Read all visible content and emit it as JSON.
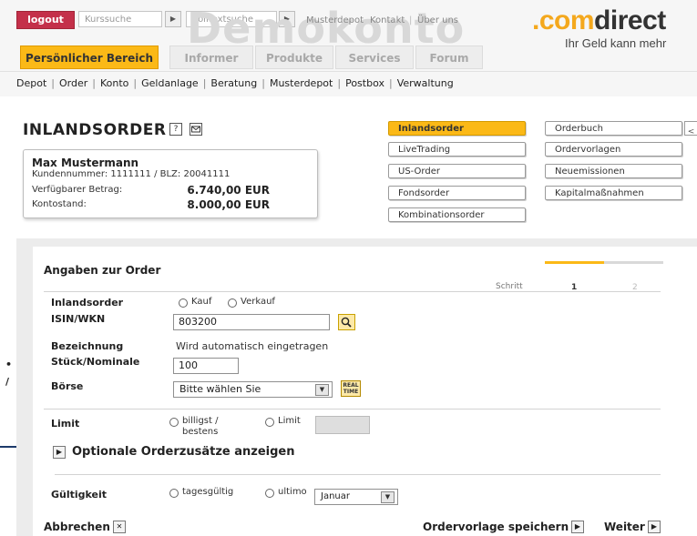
{
  "header": {
    "logout": "logout",
    "search_placeholder": "Kurssuche",
    "fulltext_placeholder": "Volltextsuche",
    "watermark": "Demokonto",
    "links": [
      "Musterdepot",
      "Kontakt",
      "Über uns"
    ],
    "logo_prefix": ".",
    "logo_com": "com",
    "logo_rest": "direct",
    "slogan": "Ihr Geld kann mehr",
    "tabs": [
      "Persönlicher Bereich",
      "Informer",
      "Produkte",
      "Services",
      "Forum"
    ],
    "active_tab": "Persönlicher Bereich"
  },
  "subnav": [
    "Depot",
    "Order",
    "Konto",
    "Geldanlage",
    "Beratung",
    "Musterdepot",
    "Postbox",
    "Verwaltung"
  ],
  "page": {
    "title": "INLANDSORDER",
    "help_icon": "?",
    "mail_icon": "mail-icon"
  },
  "customer": {
    "name": "Max Mustermann",
    "number_line": "Kundennummer: 1111111 / BLZ: 20041111",
    "available_label": "Verfügbarer Betrag:",
    "available_value": "6.740,00 EUR",
    "balance_label": "Kontostand:",
    "balance_value": "8.000,00 EUR"
  },
  "order_types": {
    "left": [
      "Inlandsorder",
      "LiveTrading",
      "US-Order",
      "Fondsorder",
      "Kombinationsorder"
    ],
    "right": [
      "Orderbuch",
      "Ordervorlagen",
      "Neuemissionen",
      "Kapitalmaßnahmen"
    ],
    "active": "Inlandsorder",
    "edge_glyph": "<"
  },
  "order": {
    "section_title": "Angaben zur Order",
    "step_label": "Schritt",
    "steps": [
      "1",
      "2"
    ],
    "current_step_fraction": 0.5,
    "fields": {
      "type_label": "Inlandsorder",
      "buy": "Kauf",
      "sell": "Verkauf",
      "isin_label": "ISIN/WKN",
      "isin_value": "803200",
      "name_label": "Bezeichnung",
      "name_value": "Wird automatisch eingetragen",
      "qty_label": "Stück/Nominale",
      "qty_value": "100",
      "exchange_label": "Börse",
      "exchange_value": "Bitte wählen Sie",
      "realtime_l1": "REAL",
      "realtime_l2": "TIME",
      "limit_label": "Limit",
      "limit_opt1_l1": "billigst /",
      "limit_opt1_l2": "bestens",
      "limit_opt2": "Limit",
      "optional_label": "Optionale Orderzusätze anzeigen",
      "validity_label": "Gültigkeit",
      "validity_opt1": "tagesgültig",
      "validity_opt2": "ultimo",
      "month_value": "Januar"
    },
    "footer": {
      "cancel": "Abbrechen",
      "save": "Ordervorlage speichern",
      "next": "Weiter"
    }
  },
  "left_margin": {
    "bullet": "•",
    "slash": "/"
  },
  "colors": {
    "accent": "#fbb917",
    "logout": "#c4304a",
    "panel_bg": "#ececec"
  }
}
